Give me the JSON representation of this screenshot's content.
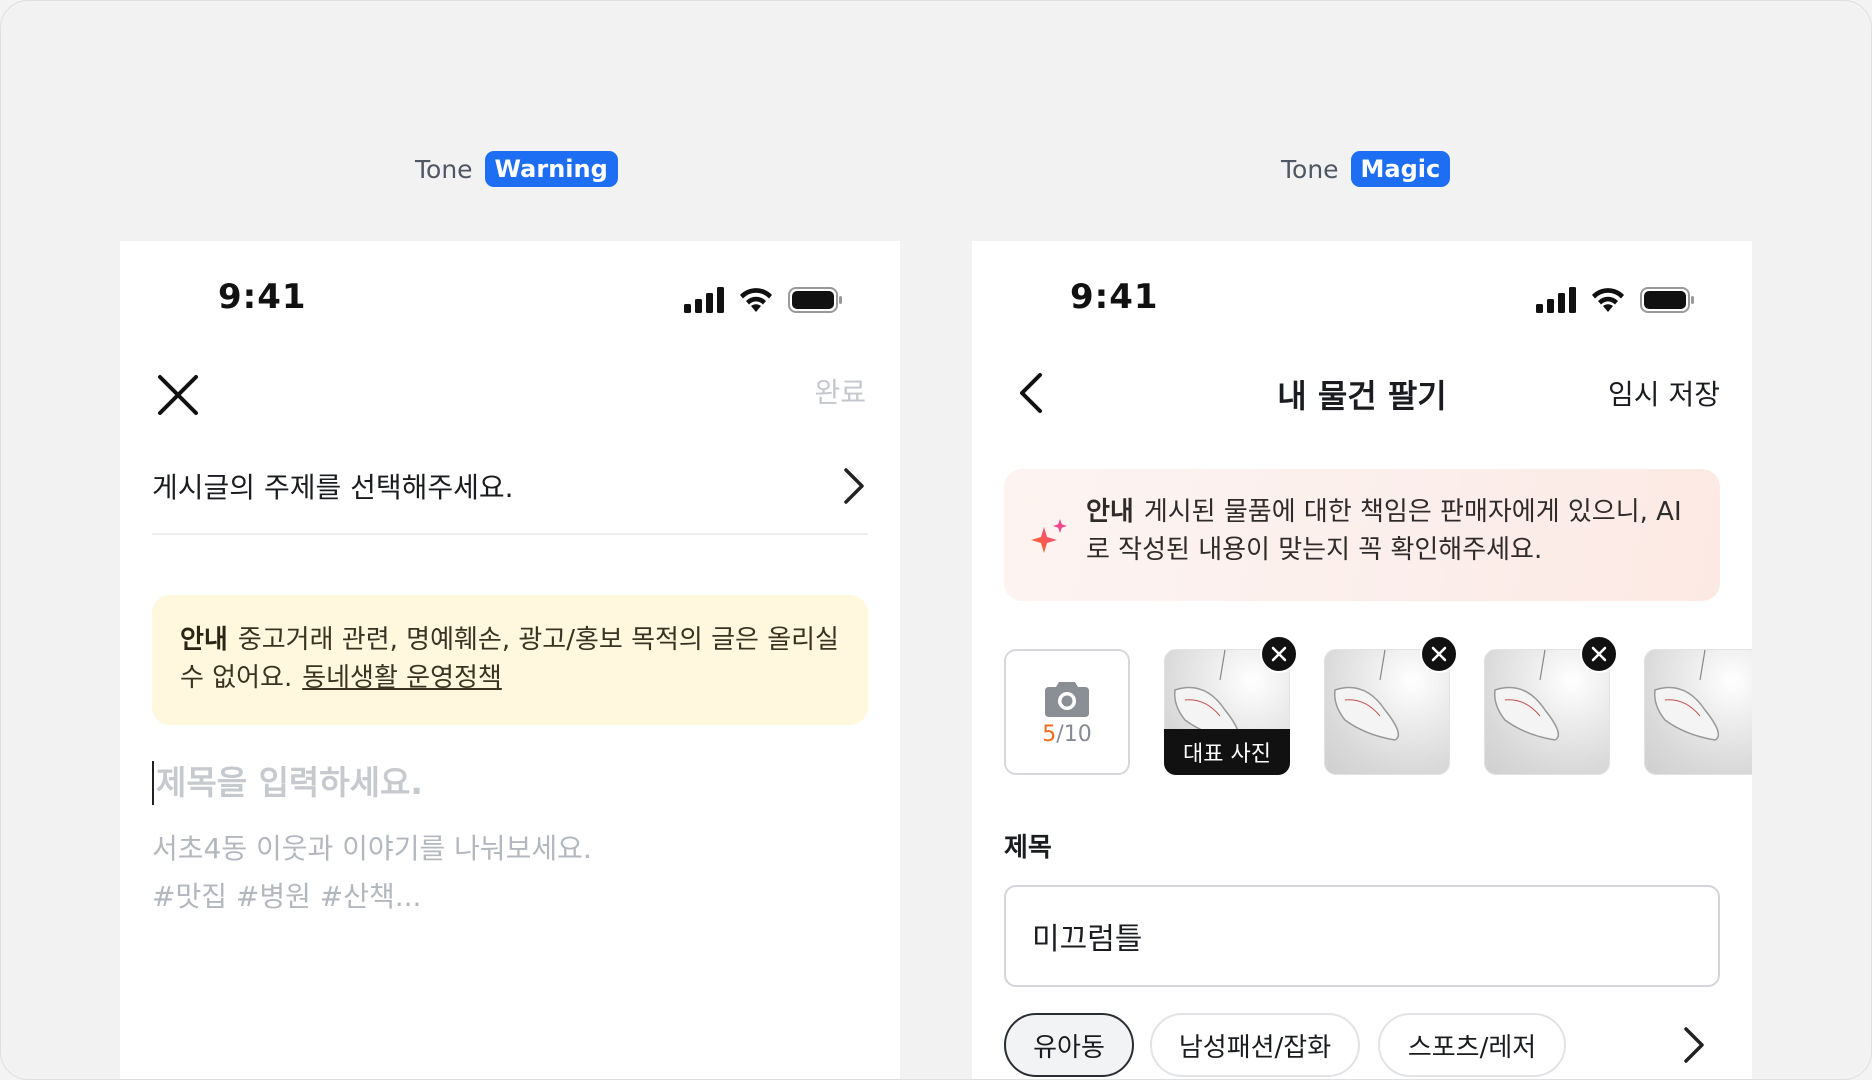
{
  "left": {
    "tone_prefix": "Tone",
    "tone_name": "Warning",
    "status": {
      "time": "9:41"
    },
    "nav": {
      "done_label": "완료"
    },
    "topic_placeholder": "게시글의 주제를 선택해주세요.",
    "notice": {
      "label": "안내",
      "text": "중고거래 관련, 명예훼손, 광고/홍보 목적의 글은 올리실 수 없어요.",
      "link": "동네생활 운영정책"
    },
    "title_placeholder": "제목을 입력하세요.",
    "body_placeholder_line1": "서초4동 이웃과 이야기를 나눠보세요.",
    "body_placeholder_line2": "#맛집 #병원 #산책..."
  },
  "right": {
    "tone_prefix": "Tone",
    "tone_name": "Magic",
    "status": {
      "time": "9:41"
    },
    "nav": {
      "title": "내 물건 팔기",
      "save_label": "임시 저장"
    },
    "notice": {
      "label": "안내",
      "text": "게시된 물품에 대한 책임은 판매자에게 있으니, AI로 작성된 내용이 맞는지 꼭 확인해주세요."
    },
    "photos": {
      "count_current": "5",
      "count_total": "/10",
      "cover_label": "대표 사진"
    },
    "title_field": {
      "label": "제목",
      "value": "미끄럼틀"
    },
    "categories": [
      "유아동",
      "남성패션/잡화",
      "스포츠/레저"
    ]
  },
  "colors": {
    "tone_badge": "#1e6ef4",
    "warning_bg": "#fff7de",
    "magic_bg": "#fbeeeb",
    "photo_count_accent": "#f36a1d"
  }
}
